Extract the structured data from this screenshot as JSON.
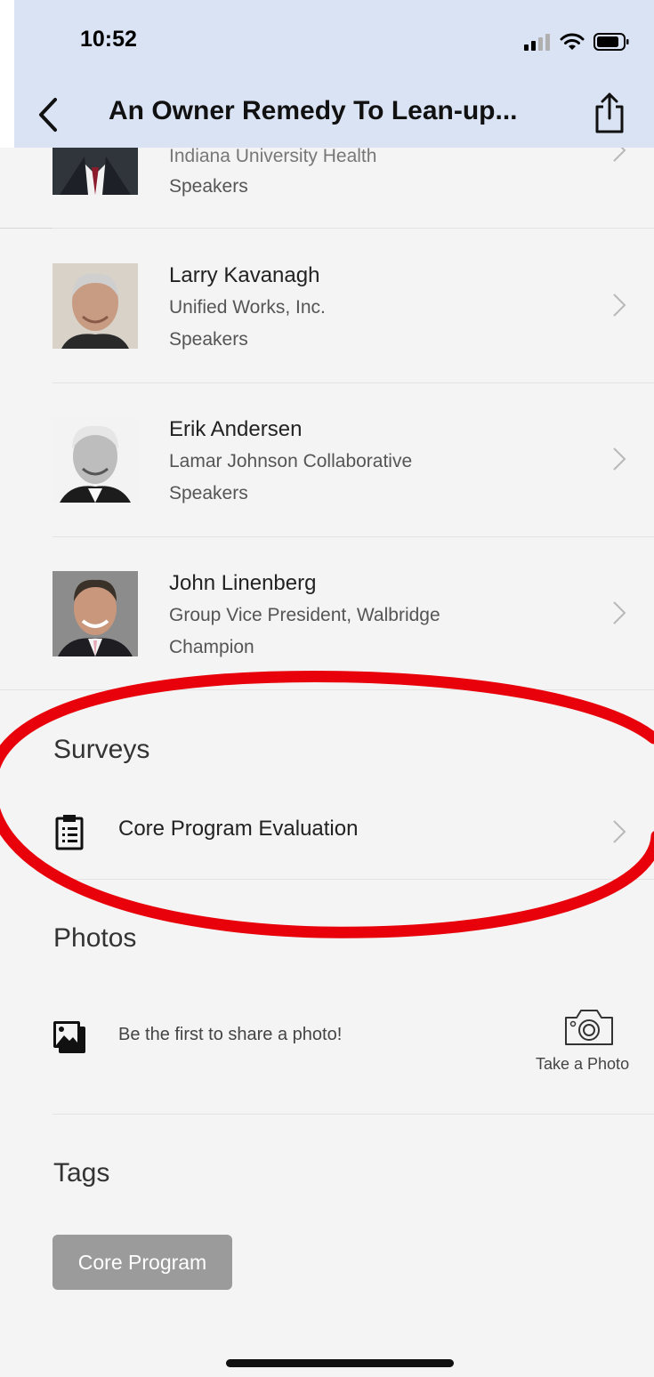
{
  "status_bar": {
    "time": "10:52"
  },
  "nav": {
    "title": "An Owner Remedy To Lean-up...",
    "back_icon": "chevron-left-icon",
    "share_icon": "share-icon"
  },
  "speakers": [
    {
      "name": "",
      "organization": "Indiana University Health",
      "role": "Speakers"
    },
    {
      "name": "Larry Kavanagh",
      "organization": "Unified Works, Inc.",
      "role": "Speakers"
    },
    {
      "name": "Erik Andersen",
      "organization": "Lamar Johnson Collaborative",
      "role": "Speakers"
    },
    {
      "name": "John Linenberg",
      "organization": "Group Vice President, Walbridge",
      "role": "Champion"
    }
  ],
  "surveys": {
    "title": "Surveys",
    "items": [
      {
        "label": "Core Program Evaluation",
        "icon": "clipboard-icon"
      }
    ]
  },
  "photos": {
    "title": "Photos",
    "empty_text": "Be the first to share a photo!",
    "take_photo_label": "Take a Photo",
    "icons": [
      "photos-icon",
      "camera-icon"
    ]
  },
  "tags": {
    "title": "Tags",
    "items": [
      "Core Program"
    ]
  },
  "colors": {
    "header_bg": "#d9e3f3",
    "page_bg": "#f4f4f4",
    "annotation_red": "#e8000a",
    "tag_bg": "#9b9b9b"
  }
}
